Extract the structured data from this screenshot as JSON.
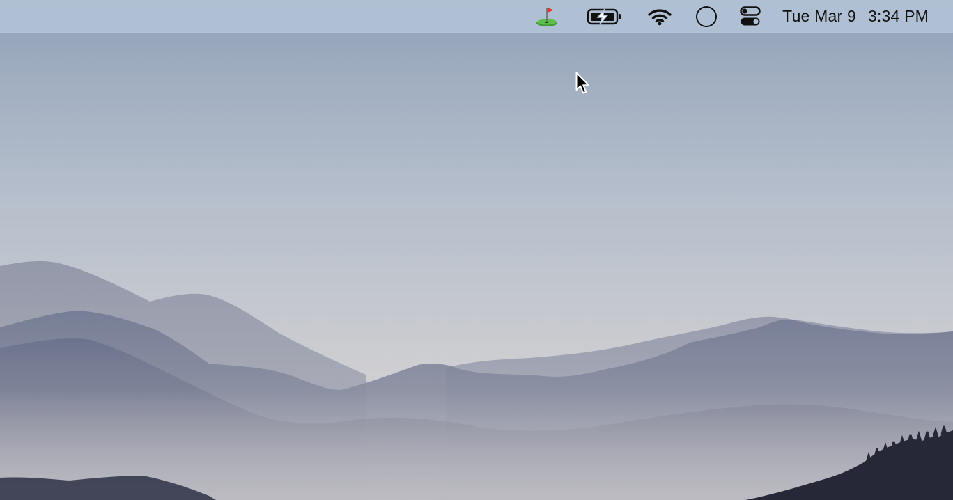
{
  "menubar": {
    "status_icons": [
      {
        "name": "golf-flag-icon"
      },
      {
        "name": "battery-charging-icon"
      },
      {
        "name": "wifi-icon"
      },
      {
        "name": "circle-icon"
      },
      {
        "name": "control-center-icon"
      }
    ],
    "clock": {
      "date": "Tue Mar 9",
      "time": "3:34 PM"
    }
  },
  "colors": {
    "menubar": "#b2c2d6",
    "sky_top": "#8e9fb6",
    "horizon": "#cfcfd2",
    "flag_red": "#e8352b",
    "grass_green": "#4cae3c"
  },
  "cursor": "arrow-pointer-icon"
}
